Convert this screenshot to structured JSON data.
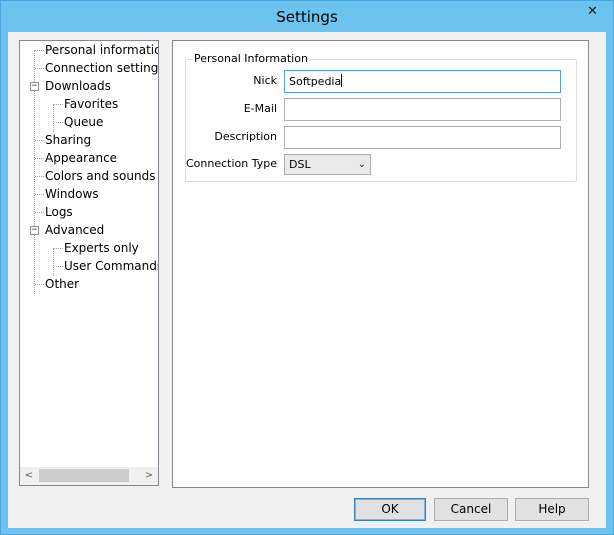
{
  "window": {
    "title": "Settings",
    "close_glyph": "✕"
  },
  "tree": {
    "items": [
      {
        "label": "Personal information"
      },
      {
        "label": "Connection settings"
      },
      {
        "label": "Downloads",
        "expander": "−"
      },
      {
        "label": "Favorites"
      },
      {
        "label": "Queue"
      },
      {
        "label": "Sharing"
      },
      {
        "label": "Appearance"
      },
      {
        "label": "Colors and sounds"
      },
      {
        "label": "Windows"
      },
      {
        "label": "Logs"
      },
      {
        "label": "Advanced",
        "expander": "−"
      },
      {
        "label": "Experts only"
      },
      {
        "label": "User Commands"
      },
      {
        "label": "Other"
      }
    ],
    "scroll_left": "<",
    "scroll_right": ">"
  },
  "personal": {
    "group_title": "Personal Information",
    "nick_label": "Nick",
    "nick_value": "Softpedia",
    "email_label": "E-Mail",
    "email_value": "",
    "description_label": "Description",
    "description_value": "",
    "connection_type_label": "Connection Type",
    "connection_type_value": "DSL"
  },
  "buttons": {
    "ok": "OK",
    "cancel": "Cancel",
    "help": "Help"
  },
  "icons": {
    "close": "close-icon",
    "expander": "minus-box-icon",
    "dropdown": "chevron-down-icon"
  }
}
